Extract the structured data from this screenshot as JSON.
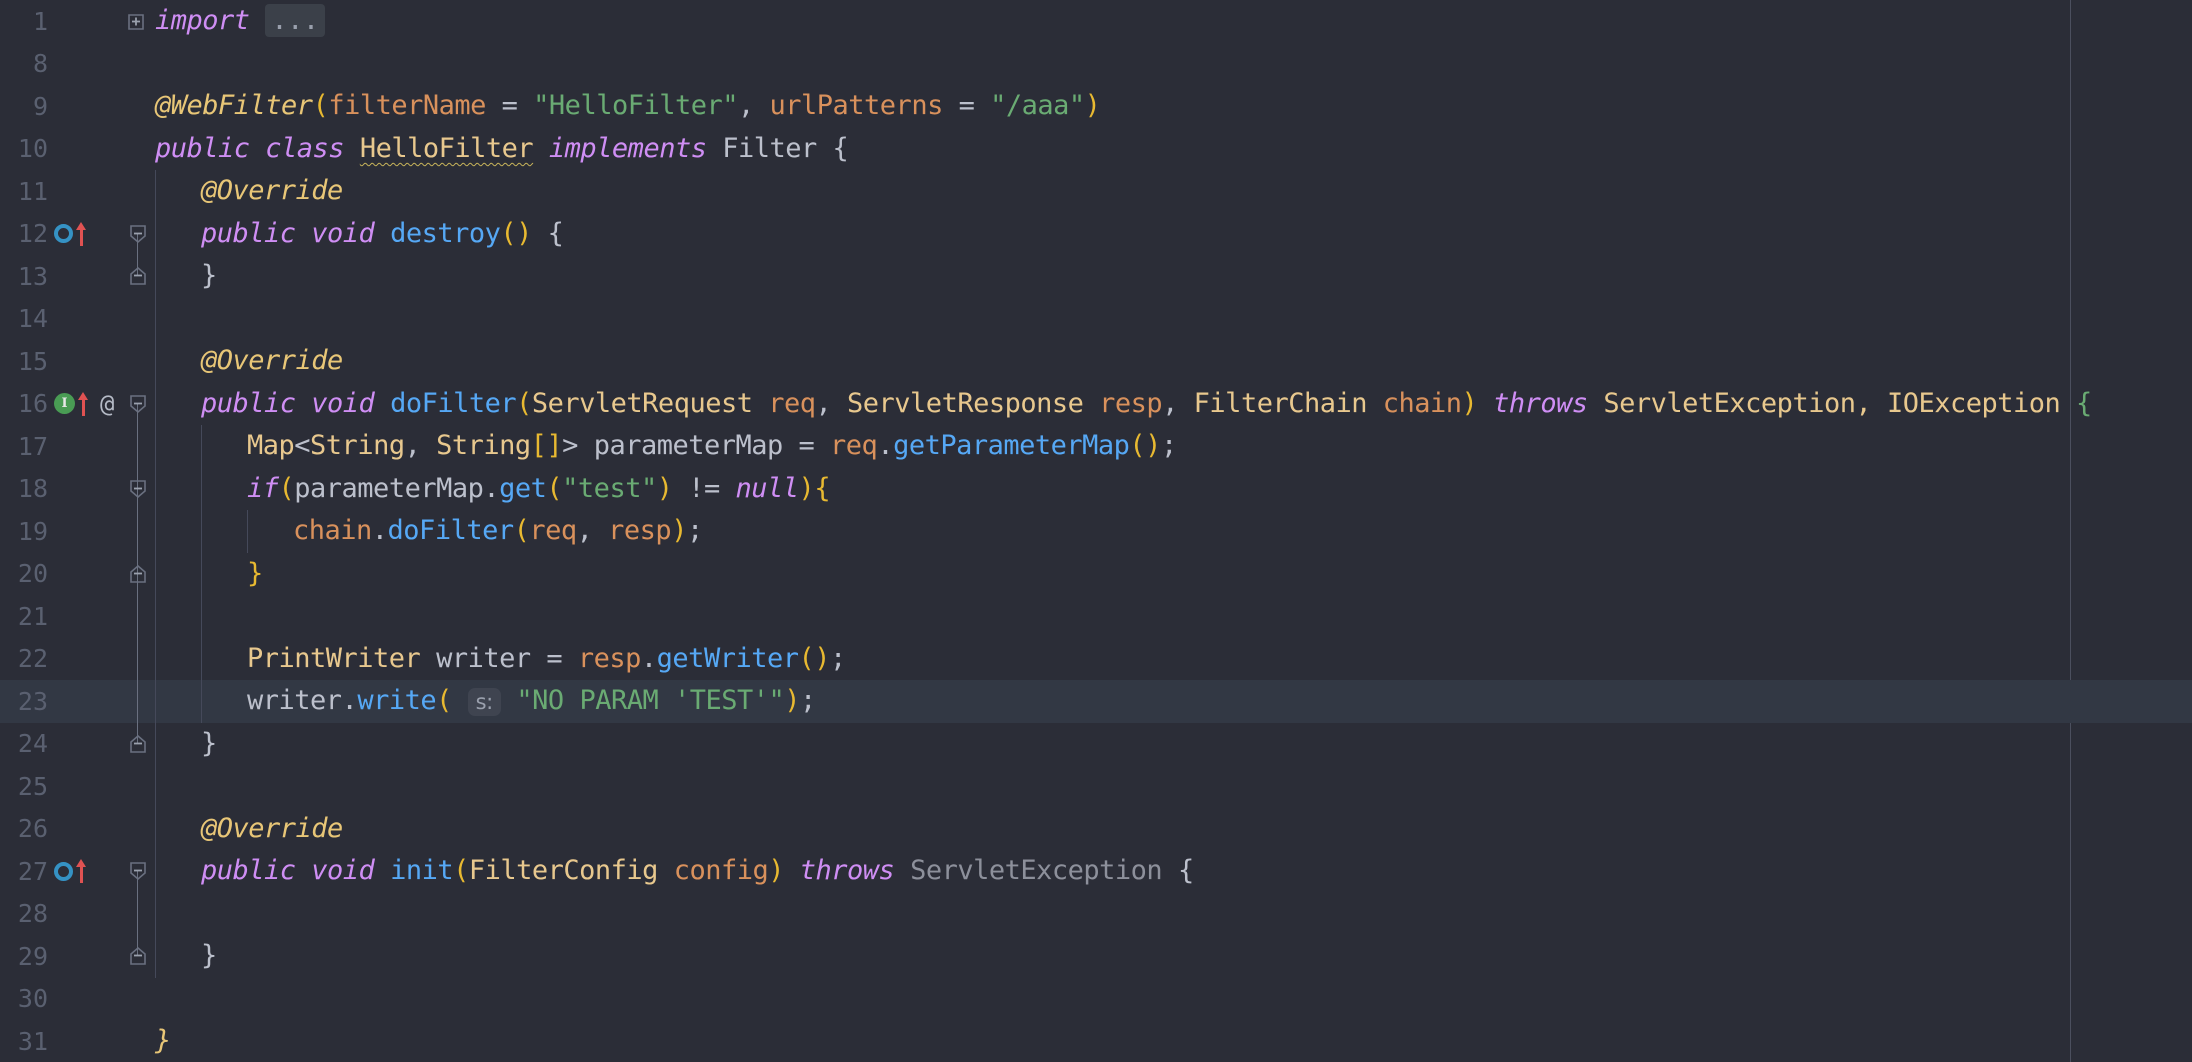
{
  "app": {
    "kind": "code-editor",
    "theme": "darcula-dark",
    "language": "java",
    "background": "#2b2d37",
    "current_line_background": "#323844",
    "line_number_color": "#5a6070",
    "margin_guide_x": 2070
  },
  "colors": {
    "keyword": "#cf8ef4",
    "annotation": "#e8c677",
    "type": "#e8c88e",
    "string": "#6aab73",
    "parameter": "#d9915c",
    "method": "#56a8f5",
    "plain_text": "#bcc0cc",
    "paren_gold": "#e8b931",
    "gutter_override_icon": "#3592c4",
    "gutter_implemented_icon": "#499c54",
    "gutter_arrow": "#e05252"
  },
  "lines": [
    {
      "number": "1",
      "current": false,
      "gutter_icons": [],
      "fold": "plus",
      "indent": 0,
      "tokens": [
        {
          "text": "import",
          "cls": "kw"
        },
        {
          "text": " ",
          "cls": "plain"
        },
        {
          "text": "...",
          "cls": "dots"
        }
      ]
    },
    {
      "number": "8",
      "current": false,
      "gutter_icons": [],
      "fold": "none",
      "indent": 0,
      "tokens": []
    },
    {
      "number": "9",
      "current": false,
      "gutter_icons": [],
      "fold": "none",
      "indent": 0,
      "tokens": [
        {
          "text": "@WebFilter",
          "cls": "anno"
        },
        {
          "text": "(",
          "cls": "paren"
        },
        {
          "text": "filterName",
          "cls": "param"
        },
        {
          "text": " = ",
          "cls": "plain"
        },
        {
          "text": "\"HelloFilter\"",
          "cls": "str"
        },
        {
          "text": ", ",
          "cls": "plain"
        },
        {
          "text": "urlPatterns",
          "cls": "param"
        },
        {
          "text": " = ",
          "cls": "plain"
        },
        {
          "text": "\"/aaa\"",
          "cls": "str"
        },
        {
          "text": ")",
          "cls": "paren"
        }
      ]
    },
    {
      "number": "10",
      "current": false,
      "gutter_icons": [],
      "fold": "none",
      "indent": 0,
      "tokens": [
        {
          "text": "public class ",
          "cls": "kw"
        },
        {
          "text": "HelloFilter",
          "cls": "typeU"
        },
        {
          "text": " ",
          "cls": "plain"
        },
        {
          "text": "implements",
          "cls": "kw"
        },
        {
          "text": " ",
          "cls": "plain"
        },
        {
          "text": "Filter",
          "cls": "plain"
        },
        {
          "text": " {",
          "cls": "plain"
        }
      ]
    },
    {
      "number": "11",
      "current": false,
      "gutter_icons": [],
      "fold": "none",
      "indent": 1,
      "tokens": [
        {
          "text": "@Override",
          "cls": "anno"
        }
      ]
    },
    {
      "number": "12",
      "current": false,
      "gutter_icons": [
        "override-icon",
        "arrow-up-icon"
      ],
      "fold": "open",
      "indent": 1,
      "tokens": [
        {
          "text": "public void ",
          "cls": "kw"
        },
        {
          "text": "destroy",
          "cls": "method"
        },
        {
          "text": "()",
          "cls": "paren"
        },
        {
          "text": " {",
          "cls": "plain"
        }
      ]
    },
    {
      "number": "13",
      "current": false,
      "gutter_icons": [],
      "fold": "close",
      "indent": 1,
      "tokens": [
        {
          "text": "}",
          "cls": "plain"
        }
      ]
    },
    {
      "number": "14",
      "current": false,
      "gutter_icons": [],
      "fold": "none",
      "indent": 1,
      "tokens": []
    },
    {
      "number": "15",
      "current": false,
      "gutter_icons": [],
      "fold": "none",
      "indent": 1,
      "tokens": [
        {
          "text": "@Override",
          "cls": "anno"
        }
      ]
    },
    {
      "number": "16",
      "current": false,
      "gutter_icons": [
        "implemented-icon",
        "arrow-up-icon",
        "at-icon"
      ],
      "fold": "open",
      "indent": 1,
      "tokens": [
        {
          "text": "public void ",
          "cls": "kw"
        },
        {
          "text": "doFilter",
          "cls": "method"
        },
        {
          "text": "(",
          "cls": "paren"
        },
        {
          "text": "ServletRequest ",
          "cls": "type"
        },
        {
          "text": "req",
          "cls": "param"
        },
        {
          "text": ", ",
          "cls": "plain"
        },
        {
          "text": "ServletResponse ",
          "cls": "type"
        },
        {
          "text": "resp",
          "cls": "param"
        },
        {
          "text": ", ",
          "cls": "plain"
        },
        {
          "text": "FilterChain ",
          "cls": "type"
        },
        {
          "text": "chain",
          "cls": "param"
        },
        {
          "text": ")",
          "cls": "paren"
        },
        {
          "text": " ",
          "cls": "plain"
        },
        {
          "text": "throws",
          "cls": "kw"
        },
        {
          "text": " ",
          "cls": "plain"
        },
        {
          "text": "ServletException, IOException",
          "cls": "type"
        },
        {
          "text": " ",
          "cls": "plain"
        },
        {
          "text": "{",
          "cls": "str"
        }
      ]
    },
    {
      "number": "17",
      "current": false,
      "gutter_icons": [],
      "fold": "none",
      "indent": 2,
      "tokens": [
        {
          "text": "Map",
          "cls": "type"
        },
        {
          "text": "<",
          "cls": "plain"
        },
        {
          "text": "String",
          "cls": "type"
        },
        {
          "text": ", ",
          "cls": "plain"
        },
        {
          "text": "String",
          "cls": "type"
        },
        {
          "text": "[]",
          "cls": "paren"
        },
        {
          "text": ">",
          "cls": "plain"
        },
        {
          "text": " parameterMap = ",
          "cls": "plain"
        },
        {
          "text": "req",
          "cls": "param"
        },
        {
          "text": ".",
          "cls": "plain"
        },
        {
          "text": "getParameterMap",
          "cls": "method"
        },
        {
          "text": "()",
          "cls": "paren"
        },
        {
          "text": ";",
          "cls": "plain"
        }
      ]
    },
    {
      "number": "18",
      "current": false,
      "gutter_icons": [],
      "fold": "open",
      "indent": 2,
      "tokens": [
        {
          "text": "if",
          "cls": "kw"
        },
        {
          "text": "(",
          "cls": "paren"
        },
        {
          "text": "parameterMap",
          "cls": "plain"
        },
        {
          "text": ".",
          "cls": "plain"
        },
        {
          "text": "get",
          "cls": "method"
        },
        {
          "text": "(",
          "cls": "paren"
        },
        {
          "text": "\"test\"",
          "cls": "str"
        },
        {
          "text": ")",
          "cls": "paren"
        },
        {
          "text": " != ",
          "cls": "plain"
        },
        {
          "text": "null",
          "cls": "kw"
        },
        {
          "text": ")",
          "cls": "paren"
        },
        {
          "text": "{",
          "cls": "paren"
        }
      ]
    },
    {
      "number": "19",
      "current": false,
      "gutter_icons": [],
      "fold": "none",
      "indent": 3,
      "tokens": [
        {
          "text": "chain",
          "cls": "param"
        },
        {
          "text": ".",
          "cls": "plain"
        },
        {
          "text": "doFilter",
          "cls": "method"
        },
        {
          "text": "(",
          "cls": "paren"
        },
        {
          "text": "req",
          "cls": "param"
        },
        {
          "text": ", ",
          "cls": "plain"
        },
        {
          "text": "resp",
          "cls": "param"
        },
        {
          "text": ")",
          "cls": "paren"
        },
        {
          "text": ";",
          "cls": "plain"
        }
      ]
    },
    {
      "number": "20",
      "current": false,
      "gutter_icons": [],
      "fold": "close",
      "indent": 2,
      "tokens": [
        {
          "text": "}",
          "cls": "paren"
        }
      ]
    },
    {
      "number": "21",
      "current": false,
      "gutter_icons": [],
      "fold": "none",
      "indent": 2,
      "tokens": []
    },
    {
      "number": "22",
      "current": false,
      "gutter_icons": [],
      "fold": "none",
      "indent": 2,
      "tokens": [
        {
          "text": "PrintWriter",
          "cls": "type"
        },
        {
          "text": " writer = ",
          "cls": "plain"
        },
        {
          "text": "resp",
          "cls": "param"
        },
        {
          "text": ".",
          "cls": "plain"
        },
        {
          "text": "getWriter",
          "cls": "method"
        },
        {
          "text": "()",
          "cls": "paren"
        },
        {
          "text": ";",
          "cls": "plain"
        }
      ]
    },
    {
      "number": "23",
      "current": true,
      "gutter_icons": [],
      "fold": "none",
      "indent": 2,
      "tokens": [
        {
          "text": "writer",
          "cls": "plain"
        },
        {
          "text": ".",
          "cls": "plain"
        },
        {
          "text": "write",
          "cls": "method"
        },
        {
          "text": "(",
          "cls": "paren"
        },
        {
          "text": " ",
          "cls": "plain"
        },
        {
          "text": "s:",
          "cls": "hint"
        },
        {
          "text": " ",
          "cls": "plain"
        },
        {
          "text": "\"NO PARAM 'TEST'\"",
          "cls": "str"
        },
        {
          "text": ")",
          "cls": "paren"
        },
        {
          "text": ";",
          "cls": "plain"
        }
      ]
    },
    {
      "number": "24",
      "current": false,
      "gutter_icons": [],
      "fold": "close",
      "indent": 1,
      "tokens": [
        {
          "text": "}",
          "cls": "plain"
        }
      ]
    },
    {
      "number": "25",
      "current": false,
      "gutter_icons": [],
      "fold": "none",
      "indent": 1,
      "tokens": []
    },
    {
      "number": "26",
      "current": false,
      "gutter_icons": [],
      "fold": "none",
      "indent": 1,
      "tokens": [
        {
          "text": "@Override",
          "cls": "anno"
        }
      ]
    },
    {
      "number": "27",
      "current": false,
      "gutter_icons": [
        "override-icon",
        "arrow-up-icon"
      ],
      "fold": "open",
      "indent": 1,
      "tokens": [
        {
          "text": "public void ",
          "cls": "kw"
        },
        {
          "text": "init",
          "cls": "method"
        },
        {
          "text": "(",
          "cls": "paren"
        },
        {
          "text": "FilterConfig ",
          "cls": "type"
        },
        {
          "text": "config",
          "cls": "param"
        },
        {
          "text": ")",
          "cls": "paren"
        },
        {
          "text": " ",
          "cls": "plain"
        },
        {
          "text": "throws",
          "cls": "kw"
        },
        {
          "text": " ",
          "cls": "plain"
        },
        {
          "text": "ServletException",
          "cls": "gray"
        },
        {
          "text": " {",
          "cls": "plain"
        }
      ]
    },
    {
      "number": "28",
      "current": false,
      "gutter_icons": [],
      "fold": "none",
      "indent": 1,
      "tokens": []
    },
    {
      "number": "29",
      "current": false,
      "gutter_icons": [],
      "fold": "close",
      "indent": 1,
      "tokens": [
        {
          "text": "}",
          "cls": "plain"
        }
      ]
    },
    {
      "number": "30",
      "current": false,
      "gutter_icons": [],
      "fold": "none",
      "indent": 0,
      "tokens": []
    },
    {
      "number": "31",
      "current": false,
      "gutter_icons": [],
      "fold": "none",
      "indent": 0,
      "tokens": [
        {
          "text": "}",
          "cls": "anno"
        }
      ]
    }
  ]
}
